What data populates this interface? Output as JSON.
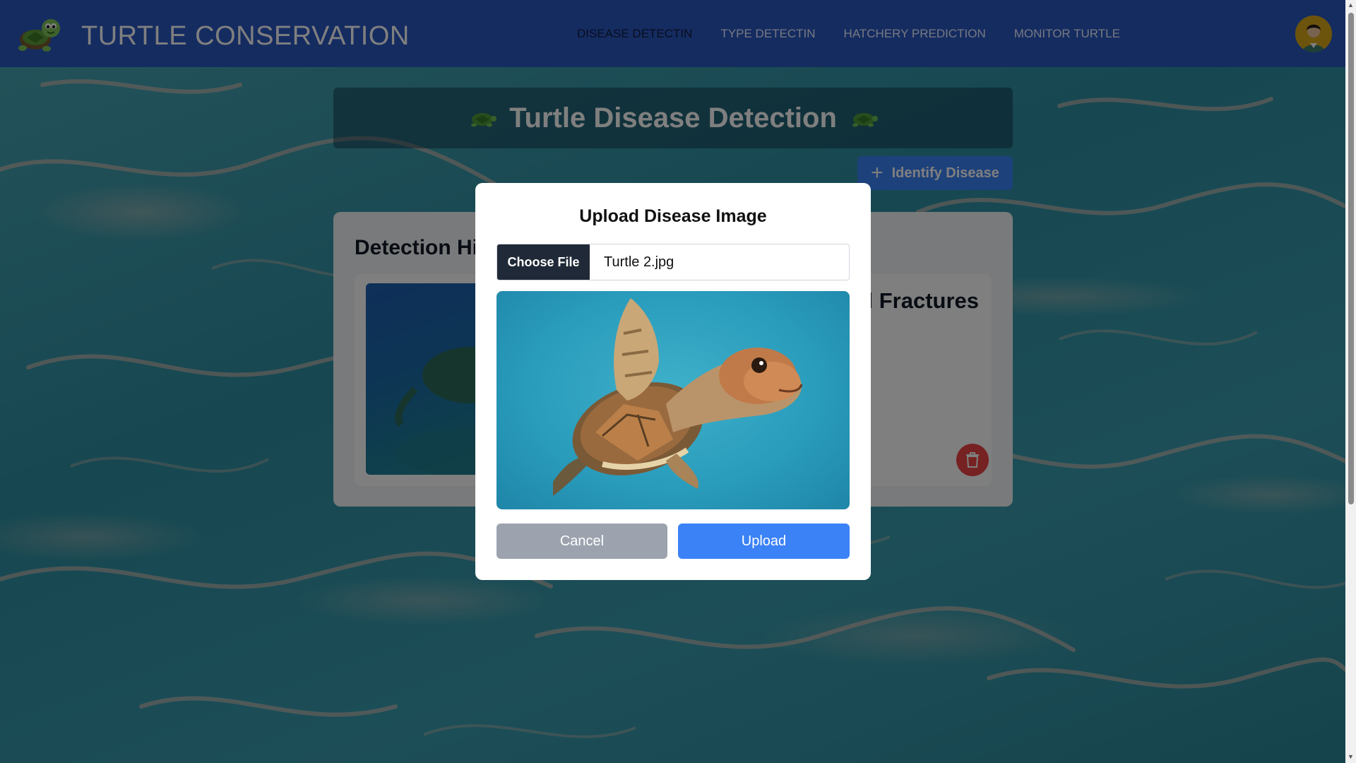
{
  "header": {
    "brand": "TURTLE CONSERVATION",
    "nav": [
      {
        "label": "DISEASE DETECTIN",
        "active": true
      },
      {
        "label": "TYPE DETECTIN",
        "active": false
      },
      {
        "label": "HATCHERY PREDICTION",
        "active": false
      },
      {
        "label": "MONITOR TURTLE",
        "active": false
      }
    ]
  },
  "page": {
    "title": "Turtle Disease Detection",
    "identify_button": "Identify Disease",
    "history_title": "Detection History",
    "history_items": [
      {
        "disease": "Shell Fractures"
      }
    ]
  },
  "modal": {
    "title": "Upload Disease Image",
    "choose_file_label": "Choose File",
    "file_name": "Turtle 2.jpg",
    "cancel_label": "Cancel",
    "upload_label": "Upload"
  },
  "colors": {
    "navbar": "#2b59c3",
    "primary": "#3b82f6",
    "danger": "#ef4444",
    "cancel": "#9ca3af"
  }
}
